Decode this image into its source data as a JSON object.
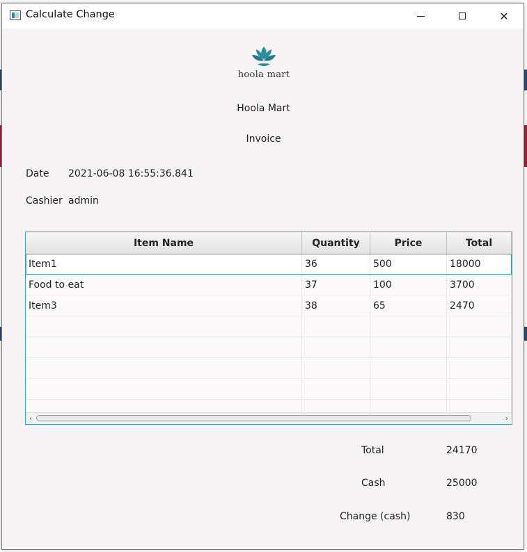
{
  "window": {
    "title": "Calculate Change",
    "controls": {
      "minimize": "minimize",
      "maximize": "maximize",
      "close": "close"
    }
  },
  "header": {
    "logo_text": "hoola mart",
    "store_name": "Hoola Mart",
    "doc_title": "Invoice"
  },
  "meta": {
    "date_label": "Date",
    "date_value": "2021-06-08 16:55:36.841",
    "cashier_label": "Cashier",
    "cashier_value": "admin"
  },
  "table": {
    "columns": [
      "Item Name",
      "Quantity",
      "Price",
      "Total"
    ],
    "rows": [
      [
        "Item1",
        "36",
        "500",
        "18000"
      ],
      [
        "Food to eat",
        "37",
        "100",
        "3700"
      ],
      [
        "Item3",
        "38",
        "65",
        "2470"
      ]
    ]
  },
  "summary": {
    "total_label": "Total",
    "total_value": "24170",
    "cash_label": "Cash",
    "cash_value": "25000",
    "change_label": "Change (cash)",
    "change_value": "830"
  },
  "colors": {
    "accent": "#3aa3c0",
    "logo": "#2a8da0",
    "window_bg": "#f6f4f5"
  }
}
